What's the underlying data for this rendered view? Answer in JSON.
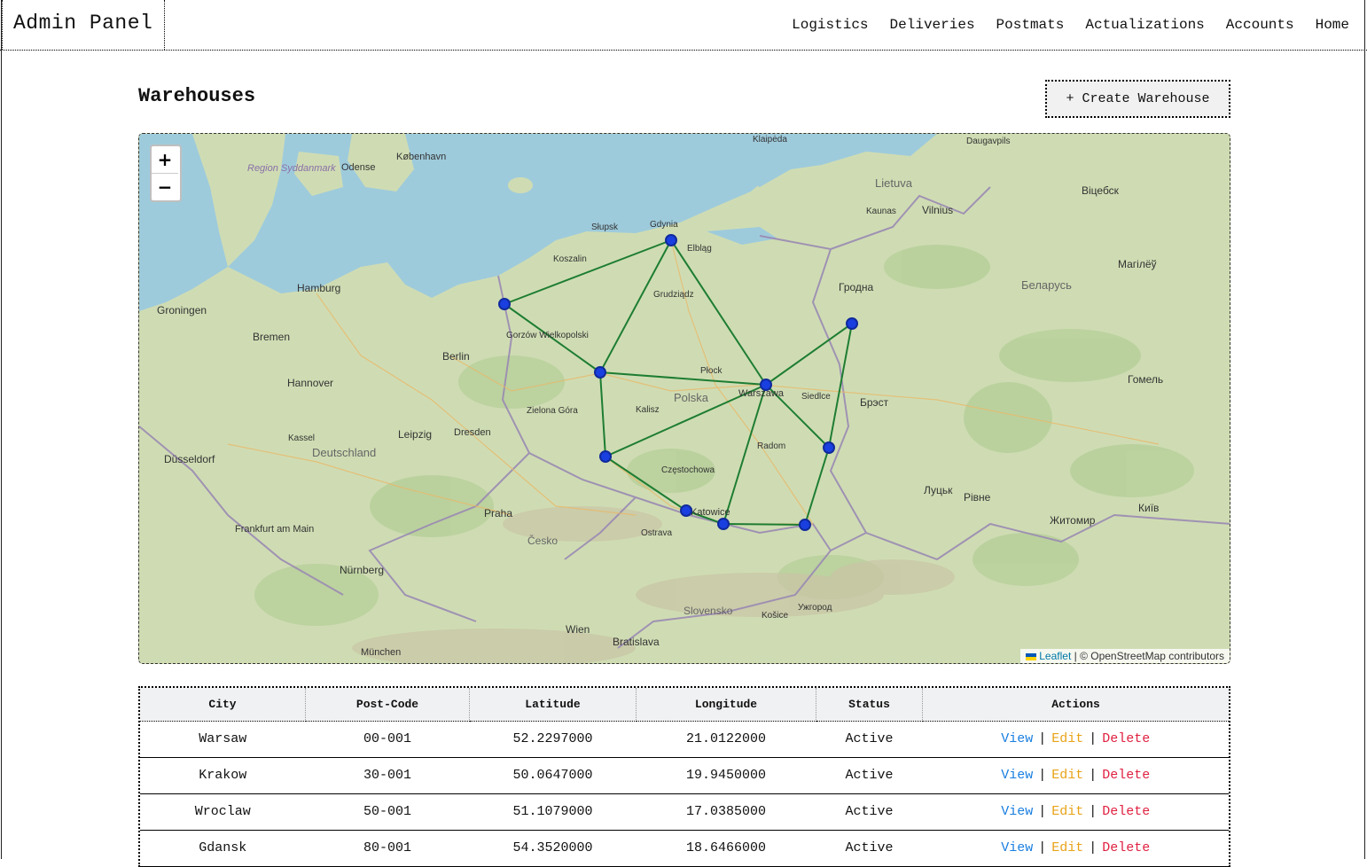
{
  "header": {
    "brand": "Admin Panel",
    "nav": [
      "Logistics",
      "Deliveries",
      "Postmats",
      "Actualizations",
      "Accounts",
      "Home"
    ]
  },
  "page": {
    "title": "Warehouses",
    "create_button": "+ Create Warehouse"
  },
  "map": {
    "zoom_in": "+",
    "zoom_out": "−",
    "attribution_link": "Leaflet",
    "attribution_text": " | © OpenStreetMap contributors",
    "colors": {
      "land": "#cfdcb3",
      "water": "#9ecbdc",
      "route": "#1e7d32",
      "marker": "#1a3fe0"
    },
    "labels": [
      {
        "text": "København"
      },
      {
        "text": "Odense"
      },
      {
        "text": "Region Syddanmark"
      },
      {
        "text": "Hamburg"
      },
      {
        "text": "Bremen"
      },
      {
        "text": "Hannover"
      },
      {
        "text": "Berlin"
      },
      {
        "text": "Leipzig"
      },
      {
        "text": "Dresden"
      },
      {
        "text": "Deutschland"
      },
      {
        "text": "Frankfurt am Main"
      },
      {
        "text": "Nürnberg"
      },
      {
        "text": "München"
      },
      {
        "text": "Praha"
      },
      {
        "text": "Česko"
      },
      {
        "text": "Wien"
      },
      {
        "text": "Bratislava"
      },
      {
        "text": "Slovensko"
      },
      {
        "text": "Polska"
      },
      {
        "text": "Warszawa"
      },
      {
        "text": "Katowice"
      },
      {
        "text": "Gdynia"
      },
      {
        "text": "Słupsk"
      },
      {
        "text": "Koszalin"
      },
      {
        "text": "Elbląg"
      },
      {
        "text": "Grudziądz"
      },
      {
        "text": "Płock"
      },
      {
        "text": "Kalisz"
      },
      {
        "text": "Radom"
      },
      {
        "text": "Częstochowa"
      },
      {
        "text": "Siedlce"
      },
      {
        "text": "Gorzów Wielkopolski"
      },
      {
        "text": "Zielona Góra"
      },
      {
        "text": "Lietuva"
      },
      {
        "text": "Kaunas"
      },
      {
        "text": "Vilnius"
      },
      {
        "text": "Daugavpils"
      },
      {
        "text": "Klaipėda"
      },
      {
        "text": "Гродна"
      },
      {
        "text": "Беларусь"
      },
      {
        "text": "Брэст"
      },
      {
        "text": "Гомель"
      },
      {
        "text": "Віцебск"
      },
      {
        "text": "Магілёў"
      },
      {
        "text": "Луцьк"
      },
      {
        "text": "Рівне"
      },
      {
        "text": "Житомир"
      },
      {
        "text": "Київ"
      },
      {
        "text": "Ostrava"
      },
      {
        "text": "Košice"
      },
      {
        "text": "Ужгород"
      },
      {
        "text": "Groningen"
      },
      {
        "text": "Düsseldorf"
      },
      {
        "text": "Kassel"
      }
    ]
  },
  "table": {
    "columns": [
      "City",
      "Post-Code",
      "Latitude",
      "Longitude",
      "Status",
      "Actions"
    ],
    "actions": {
      "view": "View",
      "edit": "Edit",
      "delete": "Delete",
      "separator": "|"
    },
    "rows": [
      {
        "city": "Warsaw",
        "post_code": "00-001",
        "lat": "52.2297000",
        "lon": "21.0122000",
        "status": "Active"
      },
      {
        "city": "Krakow",
        "post_code": "30-001",
        "lat": "50.0647000",
        "lon": "19.9450000",
        "status": "Active"
      },
      {
        "city": "Wroclaw",
        "post_code": "50-001",
        "lat": "51.1079000",
        "lon": "17.0385000",
        "status": "Active"
      },
      {
        "city": "Gdansk",
        "post_code": "80-001",
        "lat": "54.3520000",
        "lon": "18.6466000",
        "status": "Active"
      }
    ]
  }
}
